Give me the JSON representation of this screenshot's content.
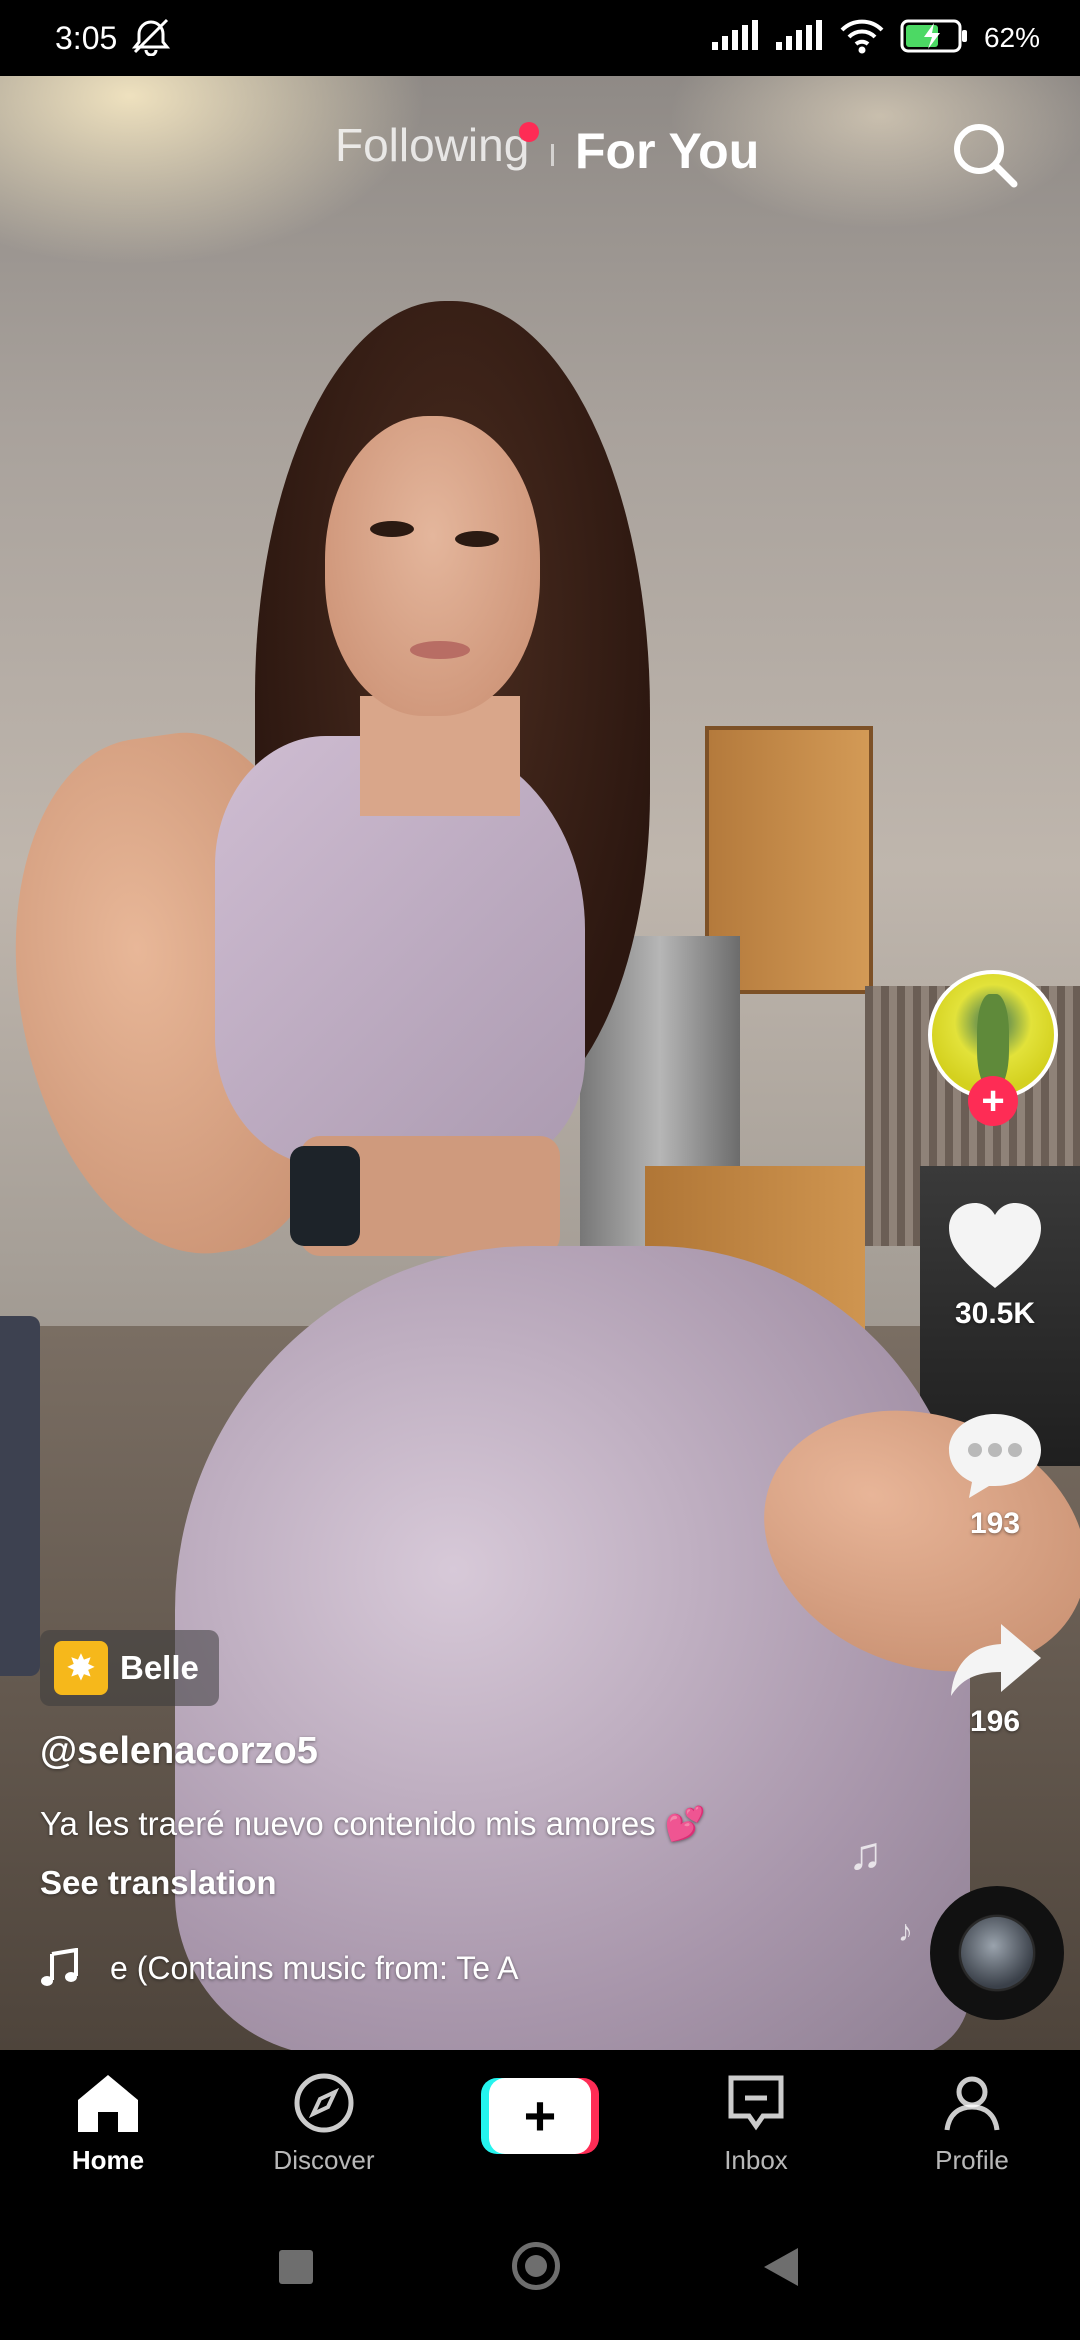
{
  "status_bar": {
    "time": "3:05",
    "battery_percent": "62%"
  },
  "feed_tabs": {
    "following": "Following",
    "for_you": "For You",
    "active": "For You"
  },
  "video": {
    "effect_label": "Belle",
    "username": "@selenacorzo5",
    "caption": "Ya les traeré nuevo contenido mis amores 💕",
    "see_translation": "See translation",
    "music_text": "e (Contains music from: Te A"
  },
  "actions": {
    "like_count": "30.5K",
    "comment_count": "193",
    "share_count": "196"
  },
  "bottom_nav": {
    "home": "Home",
    "discover": "Discover",
    "create": "+",
    "inbox": "Inbox",
    "profile": "Profile",
    "active": "Home"
  },
  "colors": {
    "accent_red": "#fe2c55",
    "accent_cyan": "#25f4ee",
    "effect_badge": "#f6b81b"
  },
  "icons": [
    "muted-alarm-icon",
    "signal-icon",
    "wifi-icon",
    "battery-charging-icon",
    "search-icon",
    "heart-icon",
    "comment-icon",
    "share-icon",
    "music-note-icon",
    "home-icon",
    "compass-icon",
    "inbox-icon",
    "profile-icon"
  ]
}
